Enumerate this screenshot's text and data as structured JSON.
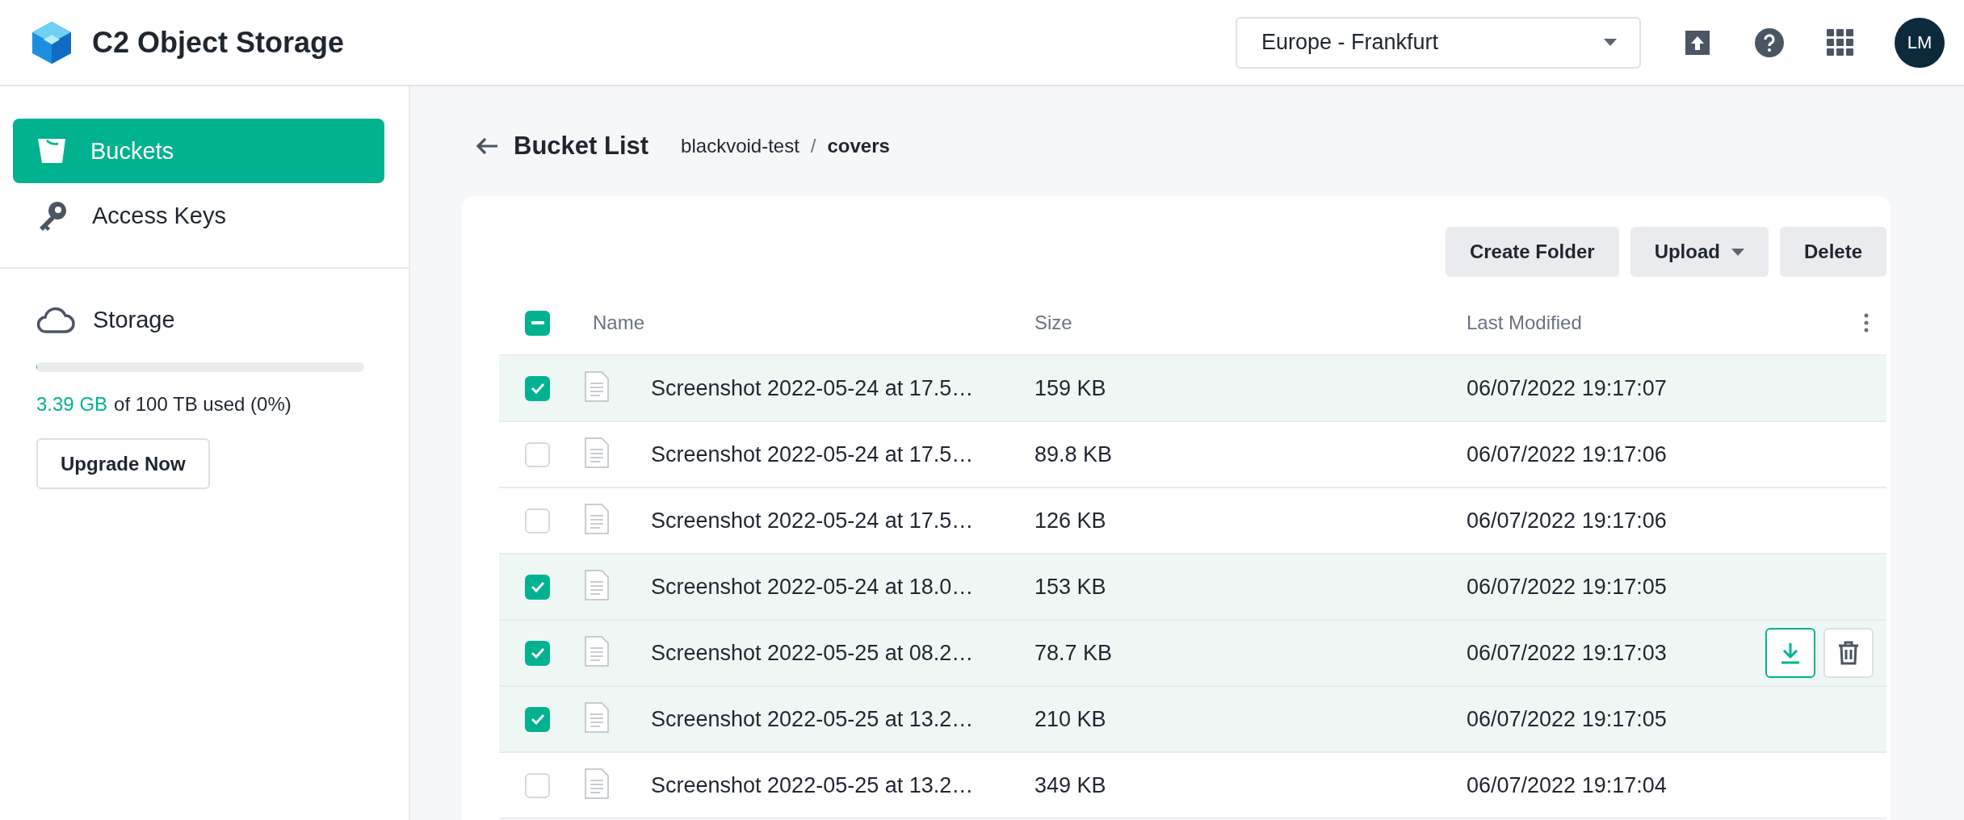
{
  "app": {
    "title": "C2 Object Storage"
  },
  "topbar": {
    "region": "Europe - Frankfurt",
    "avatar": "LM"
  },
  "sidebar": {
    "items": [
      {
        "label": "Buckets",
        "kind": "bucket",
        "selected": true
      },
      {
        "label": "Access Keys",
        "kind": "key",
        "selected": false
      }
    ],
    "storage": {
      "label": "Storage",
      "level": 0,
      "used": "3.39 GB",
      "usage_rest": "of 100 TB used (0%)",
      "upgrade_button": "Upgrade Now"
    }
  },
  "breadcrumb": {
    "title": "Bucket List",
    "separator": "/",
    "path": [
      {
        "label": "blackvoid-test",
        "current": false
      },
      {
        "label": "covers",
        "current": true
      }
    ]
  },
  "toolbar": {
    "buttons": [
      {
        "label": "Create Folder",
        "dropdown": false
      },
      {
        "label": "Upload",
        "dropdown": true
      },
      {
        "label": "Delete",
        "dropdown": false
      }
    ]
  },
  "table": {
    "select_all": {
      "indeterminate": true
    },
    "columns": [
      "Name",
      "Size",
      "Last Modified"
    ],
    "rows": [
      {
        "name": "Screenshot 2022-05-24 at 17.5…",
        "size": "159 KB",
        "modified": "06/07/2022 19:17:07",
        "selected": true,
        "hovered": false
      },
      {
        "name": "Screenshot 2022-05-24 at 17.5…",
        "size": "89.8 KB",
        "modified": "06/07/2022 19:17:06",
        "selected": false,
        "hovered": false
      },
      {
        "name": "Screenshot 2022-05-24 at 17.5…",
        "size": "126 KB",
        "modified": "06/07/2022 19:17:06",
        "selected": false,
        "hovered": false
      },
      {
        "name": "Screenshot 2022-05-24 at 18.0…",
        "size": "153 KB",
        "modified": "06/07/2022 19:17:05",
        "selected": true,
        "hovered": false
      },
      {
        "name": "Screenshot 2022-05-25 at 08.2…",
        "size": "78.7 KB",
        "modified": "06/07/2022 19:17:03",
        "selected": true,
        "hovered": true
      },
      {
        "name": "Screenshot 2022-05-25 at 13.2…",
        "size": "210 KB",
        "modified": "06/07/2022 19:17:05",
        "selected": true,
        "hovered": false
      },
      {
        "name": "Screenshot 2022-05-25 at 13.2…",
        "size": "349 KB",
        "modified": "06/07/2022 19:17:04",
        "selected": false,
        "hovered": false
      }
    ]
  }
}
